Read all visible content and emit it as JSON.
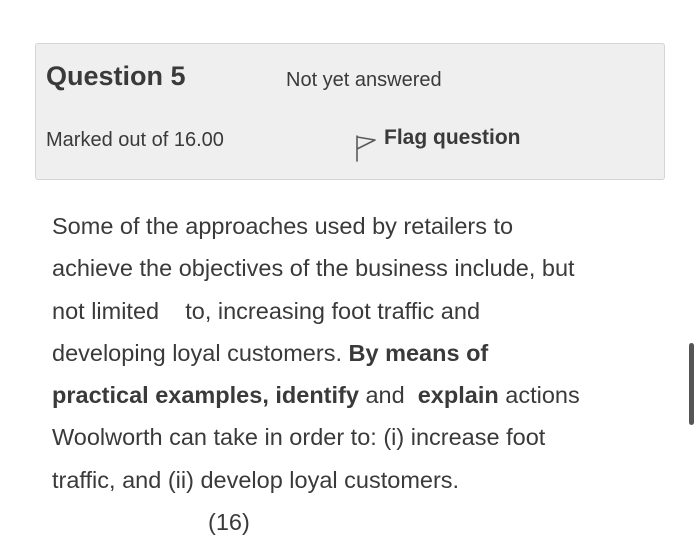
{
  "question_info": {
    "label": "Question",
    "number": "5",
    "state": "Not yet answered",
    "grade": "Marked out of 16.00",
    "flag_label": "Flag question",
    "flag_icon": "flag-outline-icon"
  },
  "question_text": {
    "line1": "Some of the approaches used by retailers to",
    "line2": "achieve the objectives of the business include, but",
    "line3": "not limited    to, increasing foot traffic and",
    "line4_plain": "developing loyal customers. ",
    "line4_bold": "By means of",
    "line5_bold1": "practical examples, identify",
    "line5_plain1": " and  ",
    "line5_bold2": "explain",
    "line5_plain2": " actions",
    "line6": "Woolworth can take in order to: (i) increase foot",
    "line7": "traffic, and (ii) develop loyal customers.",
    "marks": "(16)"
  }
}
